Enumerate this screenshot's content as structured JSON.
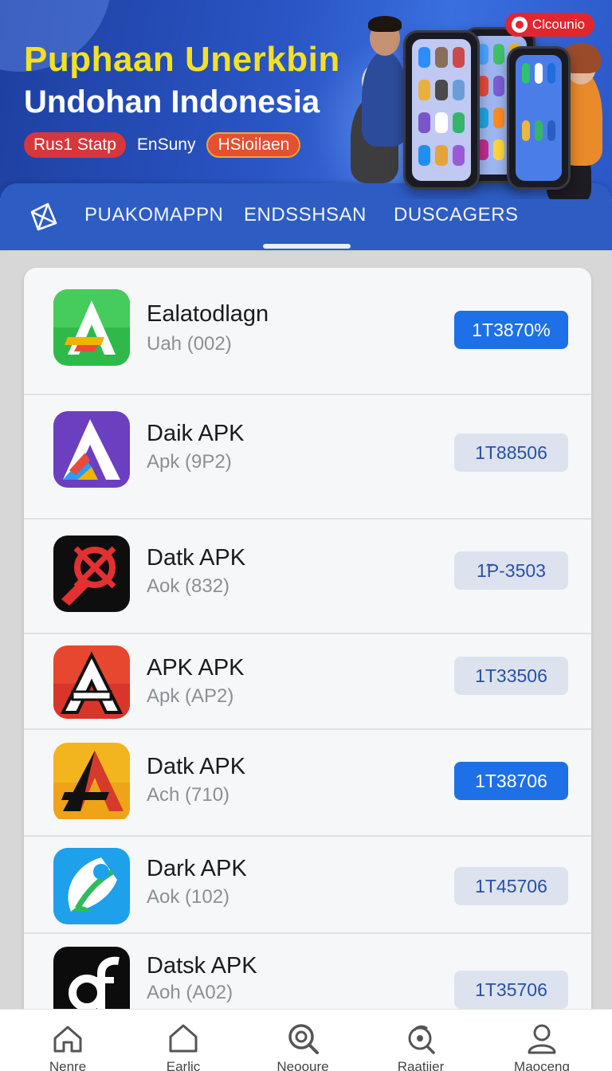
{
  "banner": {
    "title": "Puphaan Unerkbin",
    "subtitle": "Undohan Indonesia",
    "tags": [
      "Rus1 Statp",
      "EnSuny",
      "HSioilaen"
    ],
    "badge": "Clcounio"
  },
  "tabs": {
    "items": [
      "PUAKOMAPPN",
      "ENDSSHSAN",
      "DUSCAGERS"
    ],
    "active_index": 1
  },
  "apps": [
    {
      "name": "Ealatodlagn",
      "sub": "Uah (002)",
      "value": "1T3870%",
      "style": "primary",
      "icon": "green-a-icon"
    },
    {
      "name": "Daik APK",
      "sub": "Apk (9P2)",
      "value": "1T88506",
      "style": "secondary",
      "icon": "purple-a-icon"
    },
    {
      "name": "Datk APK",
      "sub": "Aok (832)",
      "value": "1̃P-3503",
      "style": "secondary",
      "icon": "red-key-icon"
    },
    {
      "name": "APK APK",
      "sub": "Apk (AP2)",
      "value": "1T33506",
      "style": "secondary",
      "icon": "orange-a-icon"
    },
    {
      "name": "Datk APK",
      "sub": "Ach (710)",
      "value": "1T38706",
      "style": "primary",
      "icon": "yellow-a-icon"
    },
    {
      "name": "Dark APK",
      "sub": "Aok (102)",
      "value": "1T45706",
      "style": "secondary",
      "icon": "blue-leaf-icon"
    },
    {
      "name": "Datsk APK",
      "sub": "Aoh (A02)",
      "value": "1T35706",
      "style": "secondary",
      "icon": "black-d-icon"
    }
  ],
  "bottom_nav": [
    {
      "label": "Nenre",
      "icon": "home-icon"
    },
    {
      "label": "Earlic",
      "icon": "house-outline-icon"
    },
    {
      "label": "Neooure",
      "icon": "search-icon"
    },
    {
      "label": "Raatiier",
      "icon": "discover-icon"
    },
    {
      "label": "Maoceng",
      "icon": "profile-icon"
    }
  ],
  "colors": {
    "banner_blue": "#2a55c4",
    "title_yellow": "#f3e125",
    "primary_button": "#1e70e6",
    "secondary_button": "#dce3ee",
    "badge_red": "#e0272f"
  }
}
